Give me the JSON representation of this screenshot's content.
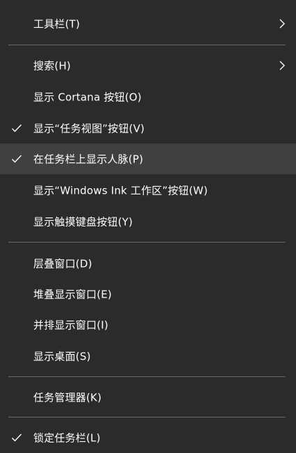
{
  "menu": {
    "items": [
      {
        "label": "工具栏(T)",
        "checked": false,
        "submenu": true
      },
      {
        "label": "搜索(H)",
        "checked": false,
        "submenu": true
      },
      {
        "label": "显示 Cortana 按钮(O)",
        "checked": false,
        "submenu": false
      },
      {
        "label": "显示“任务视图”按钮(V)",
        "checked": true,
        "submenu": false
      },
      {
        "label": "在任务栏上显示人脉(P)",
        "checked": true,
        "submenu": false,
        "hover": true
      },
      {
        "label": "显示“Windows Ink 工作区”按钮(W)",
        "checked": false,
        "submenu": false
      },
      {
        "label": "显示触摸键盘按钮(Y)",
        "checked": false,
        "submenu": false
      },
      {
        "label": "层叠窗口(D)",
        "checked": false,
        "submenu": false
      },
      {
        "label": "堆叠显示窗口(E)",
        "checked": false,
        "submenu": false
      },
      {
        "label": "并排显示窗口(I)",
        "checked": false,
        "submenu": false
      },
      {
        "label": "显示桌面(S)",
        "checked": false,
        "submenu": false
      },
      {
        "label": "任务管理器(K)",
        "checked": false,
        "submenu": false
      },
      {
        "label": "锁定任务栏(L)",
        "checked": true,
        "submenu": false
      }
    ]
  },
  "icons": {
    "check": "checkmark-icon",
    "submenu": "chevron-right-icon"
  },
  "colors": {
    "background": "#2b2b2b",
    "hover": "#404040",
    "separator": "#6b6b6b",
    "text": "#ffffff"
  }
}
